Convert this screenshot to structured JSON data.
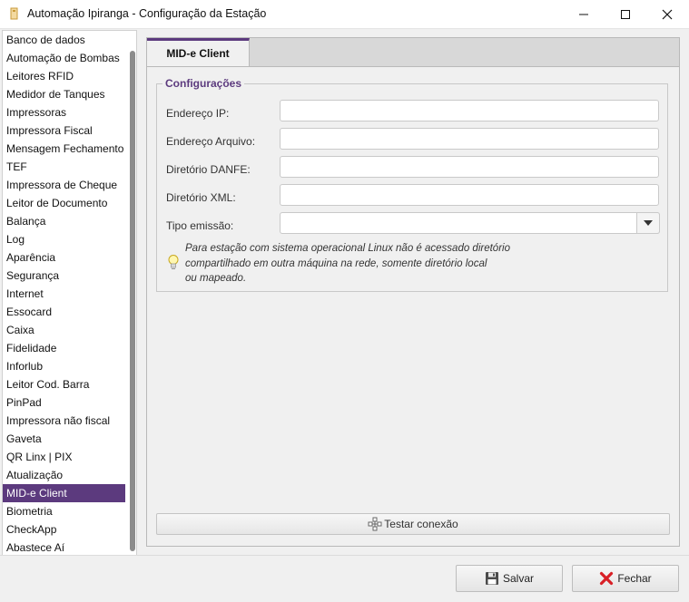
{
  "window": {
    "title": "Automação Ipiranga - Configuração da Estação",
    "controls": {
      "minimize": "minimize-icon",
      "maximize": "maximize-icon",
      "close": "close-icon"
    }
  },
  "sidebar": {
    "items": [
      {
        "label": "Banco de dados"
      },
      {
        "label": "Automação de Bombas"
      },
      {
        "label": "Leitores RFID"
      },
      {
        "label": "Medidor de Tanques"
      },
      {
        "label": "Impressoras"
      },
      {
        "label": "Impressora Fiscal"
      },
      {
        "label": "Mensagem Fechamento"
      },
      {
        "label": "TEF"
      },
      {
        "label": "Impressora de Cheque"
      },
      {
        "label": "Leitor de Documento"
      },
      {
        "label": "Balança"
      },
      {
        "label": "Log"
      },
      {
        "label": "Aparência"
      },
      {
        "label": "Segurança"
      },
      {
        "label": "Internet"
      },
      {
        "label": "Essocard"
      },
      {
        "label": "Caixa"
      },
      {
        "label": "Fidelidade"
      },
      {
        "label": "Inforlub"
      },
      {
        "label": "Leitor Cod. Barra"
      },
      {
        "label": "PinPad"
      },
      {
        "label": "Impressora não fiscal"
      },
      {
        "label": "Gaveta"
      },
      {
        "label": "QR Linx | PIX"
      },
      {
        "label": "Atualização"
      },
      {
        "label": "MID-e Client",
        "selected": true
      },
      {
        "label": "Biometria"
      },
      {
        "label": "CheckApp"
      },
      {
        "label": "Abastece Aí"
      }
    ],
    "selected_color": "#5c3a7e"
  },
  "main": {
    "tab_label": "MID-e Client",
    "group_title": "Configurações",
    "fields": {
      "ip": {
        "label": "Endereço IP:",
        "value": ""
      },
      "arquivo": {
        "label": "Endereço Arquivo:",
        "value": ""
      },
      "danfe": {
        "label": "Diretório DANFE:",
        "value": ""
      },
      "xml": {
        "label": "Diretório XML:",
        "value": ""
      },
      "tipo_emissao": {
        "label": "Tipo emissão:",
        "value": ""
      }
    },
    "info": {
      "icon": "lightbulb-icon",
      "line1": "Para estação com sistema operacional Linux não é acessado diretório",
      "line2": "compartilhado em outra máquina na rede, somente diretório local",
      "line3": "ou mapeado."
    },
    "test_button": {
      "label": "Testar conexão",
      "icon": "network-icon"
    }
  },
  "footer": {
    "save": {
      "label": "Salvar",
      "icon": "floppy-disk-icon"
    },
    "close": {
      "label": "Fechar",
      "icon": "red-x-icon"
    }
  },
  "colors": {
    "accent": "#5c3a7e",
    "close_x": "#d81f26"
  }
}
